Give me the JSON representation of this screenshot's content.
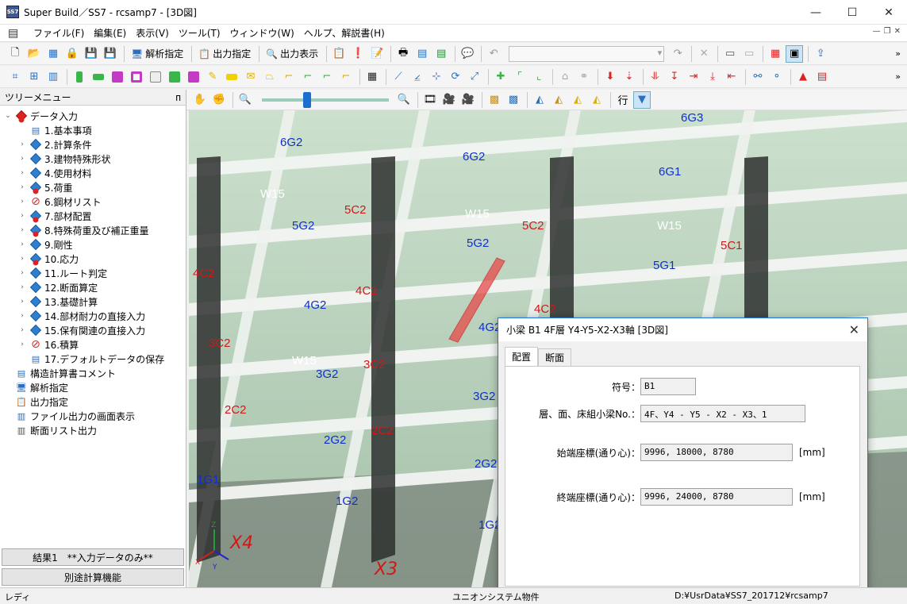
{
  "window": {
    "title": "Super Build／SS7 - rcsamp7 - [3D図]",
    "app_icon_text": "SS7",
    "minimize": "—",
    "maximize": "☐",
    "close": "✕"
  },
  "menubar": {
    "items": [
      "ファイル(F)",
      "編集(E)",
      "表示(V)",
      "ツール(T)",
      "ウィンドウ(W)",
      "ヘルプ、解説書(H)"
    ]
  },
  "toolbar1": {
    "analysis_label": "解析指定",
    "output_spec_label": "出力指定",
    "output_view_label": "出力表示"
  },
  "tree": {
    "header": "ツリーメニュー",
    "pin": "ᴨ",
    "root_label": "データ入力",
    "items": [
      {
        "label": "1.基本事項",
        "icon": "doc"
      },
      {
        "label": "2.計算条件",
        "icon": "diamond"
      },
      {
        "label": "3.建物特殊形状",
        "icon": "diamond"
      },
      {
        "label": "4.使用材料",
        "icon": "diamond"
      },
      {
        "label": "5.荷重",
        "icon": "diamond-red"
      },
      {
        "label": "6.鋼材リスト",
        "icon": "prohibit"
      },
      {
        "label": "7.部材配置",
        "icon": "diamond-red"
      },
      {
        "label": "8.特殊荷重及び補正重量",
        "icon": "diamond-red"
      },
      {
        "label": "9.剛性",
        "icon": "diamond"
      },
      {
        "label": "10.応力",
        "icon": "diamond-red"
      },
      {
        "label": "11.ルート判定",
        "icon": "diamond"
      },
      {
        "label": "12.断面算定",
        "icon": "diamond"
      },
      {
        "label": "13.基礎計算",
        "icon": "diamond"
      },
      {
        "label": "14.部材耐力の直接入力",
        "icon": "diamond"
      },
      {
        "label": "15.保有関連の直接入力",
        "icon": "diamond"
      },
      {
        "label": "16.積算",
        "icon": "prohibit"
      },
      {
        "label": "17.デフォルトデータの保存",
        "icon": "doc"
      }
    ],
    "top_items": [
      {
        "label": "構造計算書コメント"
      },
      {
        "label": "解析指定"
      },
      {
        "label": "出力指定"
      },
      {
        "label": "ファイル出力の画面表示"
      },
      {
        "label": "断面リスト出力"
      }
    ],
    "result_button": "結果1　**入力データのみ**",
    "separate_calc_button": "別途計算機能"
  },
  "viewer": {
    "row_label": "行",
    "axis_labels": {
      "x4": "X4",
      "x3": "X3",
      "axis_x": "X",
      "axis_y": "Y",
      "axis_z": "Z"
    },
    "member_labels": [
      {
        "t": "6G3",
        "c": "blue"
      },
      {
        "t": "6G2",
        "c": "blue"
      },
      {
        "t": "6G2",
        "c": "blue"
      },
      {
        "t": "6G1",
        "c": "blue"
      },
      {
        "t": "5C2",
        "c": "red"
      },
      {
        "t": "5C2",
        "c": "red"
      },
      {
        "t": "5C1",
        "c": "red"
      },
      {
        "t": "5G2",
        "c": "blue"
      },
      {
        "t": "5G2",
        "c": "blue"
      },
      {
        "t": "5G1",
        "c": "blue"
      },
      {
        "t": "W15",
        "c": "white"
      },
      {
        "t": "W15",
        "c": "white"
      },
      {
        "t": "W15",
        "c": "white"
      },
      {
        "t": "W15",
        "c": "white"
      },
      {
        "t": "4C2",
        "c": "red"
      },
      {
        "t": "4C2",
        "c": "red"
      },
      {
        "t": "4C2",
        "c": "red"
      },
      {
        "t": "4G2",
        "c": "blue"
      },
      {
        "t": "4G2",
        "c": "blue"
      },
      {
        "t": "3C2",
        "c": "red"
      },
      {
        "t": "3C2",
        "c": "red"
      },
      {
        "t": "3G2",
        "c": "blue"
      },
      {
        "t": "3G2",
        "c": "blue"
      },
      {
        "t": "2C2",
        "c": "red"
      },
      {
        "t": "2C2",
        "c": "red"
      },
      {
        "t": "2G2",
        "c": "blue"
      },
      {
        "t": "2G2",
        "c": "blue"
      },
      {
        "t": "1G1",
        "c": "blue"
      },
      {
        "t": "1G2",
        "c": "blue"
      },
      {
        "t": "1G2",
        "c": "blue"
      }
    ]
  },
  "dialog": {
    "title": "小梁 B1 4F層 Y4-Y5-X2-X3軸 [3D図]",
    "close": "✕",
    "tabs": [
      "配置",
      "断面"
    ],
    "active_tab": "配置",
    "fields": {
      "symbol_label": "符号：",
      "symbol_value": "B1",
      "floor_label": "層、面、床組小梁No.：",
      "floor_value": "4F、Y4 - Y5 - X2 - X3、1",
      "start_label": "始端座標(通り心)：",
      "start_value": "9996, 18000, 8780",
      "end_label": "終端座標(通り心)：",
      "end_value": "9996, 24000, 8780",
      "unit": "[mm]"
    }
  },
  "statusbar": {
    "left": "レディ",
    "center": "ユニオンシステム物件",
    "right": "D:¥UsrData¥SS7_201712¥rcsamp7"
  },
  "colors": {
    "accent": "#1e78d6",
    "label_blue": "#1030c8",
    "label_red": "#d01818",
    "selected_beam": "#e84a4a"
  }
}
